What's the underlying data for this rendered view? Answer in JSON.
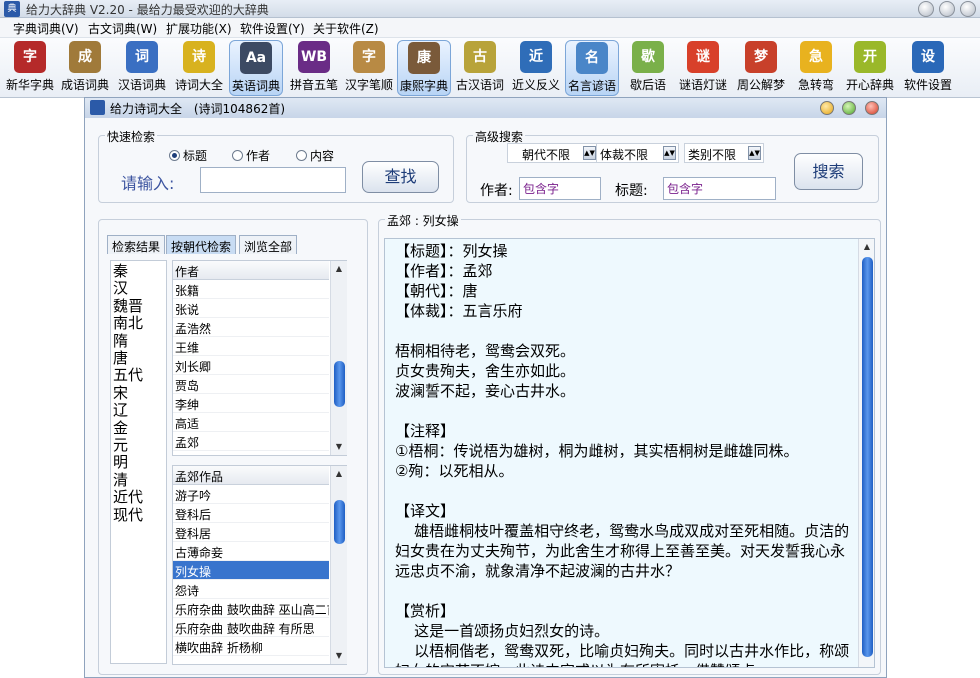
{
  "window": {
    "title": "给力大辞典 V2.20  -  最给力最受欢迎的大辞典"
  },
  "menu": [
    "字典词典(V)",
    "古文词典(W)",
    "扩展功能(X)",
    "软件设置(Y)",
    "关于软件(Z)"
  ],
  "toolbar": [
    {
      "label": "新华字典",
      "icon": "dictionary-icon",
      "color": "#b52a2a",
      "glyph": "字"
    },
    {
      "label": "成语词典",
      "icon": "idiom-book-icon",
      "color": "#a07a3a",
      "glyph": "成"
    },
    {
      "label": "汉语词典",
      "icon": "chinese-dict-icon",
      "color": "#3a6fc2",
      "glyph": "词"
    },
    {
      "label": "诗词大全",
      "icon": "poetry-icon",
      "color": "#d8b21f",
      "glyph": "诗"
    },
    {
      "label": "英语词典",
      "icon": "english-dict-icon",
      "color": "#3c4a63",
      "glyph": "Aa"
    },
    {
      "label": "拼音五笔",
      "icon": "wubi-icon",
      "color": "#6a2c86",
      "glyph": "WB"
    },
    {
      "label": "汉字笔顺",
      "icon": "stroke-order-icon",
      "color": "#b88a44",
      "glyph": "字"
    },
    {
      "label": "康熙字典",
      "icon": "kangxi-icon",
      "color": "#7a5a3a",
      "glyph": "康"
    },
    {
      "label": "古汉语词",
      "icon": "ancient-chinese-icon",
      "color": "#b8a33a",
      "glyph": "古"
    },
    {
      "label": "近义反义",
      "icon": "synonym-icon",
      "color": "#2f6db8",
      "glyph": "近"
    },
    {
      "label": "名言谚语",
      "icon": "proverb-icon",
      "color": "#4a86c8",
      "glyph": "名"
    },
    {
      "label": "歇后语",
      "icon": "xiehouyu-icon",
      "color": "#7ab04a",
      "glyph": "歇"
    },
    {
      "label": "谜语灯谜",
      "icon": "riddle-icon",
      "color": "#d8402a",
      "glyph": "谜"
    },
    {
      "label": "周公解梦",
      "icon": "dream-icon",
      "color": "#c8402a",
      "glyph": "梦"
    },
    {
      "label": "急转弯",
      "icon": "lightbulb-icon",
      "color": "#e8b21f",
      "glyph": "急"
    },
    {
      "label": "开心辞典",
      "icon": "happy-dict-icon",
      "color": "#9ab82a",
      "glyph": "开"
    },
    {
      "label": "软件设置",
      "icon": "gear-icon",
      "color": "#2a68b8",
      "glyph": "设"
    }
  ],
  "child": {
    "title": "给力诗词大全",
    "count": "(诗词104862首)"
  },
  "quick_search": {
    "label": "快速检索",
    "radios": [
      {
        "label": "标题",
        "checked": true
      },
      {
        "label": "作者",
        "checked": false
      },
      {
        "label": "内容",
        "checked": false
      }
    ],
    "prompt": "请输入:",
    "button": "查找"
  },
  "advanced_search": {
    "label": "高级搜索",
    "selects": [
      "朝代不限",
      "体裁不限",
      "类别不限"
    ],
    "author_label": "作者:",
    "author_value": "包含字",
    "title_label": "标题:",
    "title_value": "包含字",
    "button": "搜索"
  },
  "tabs": [
    "检索结果",
    "按朝代检索",
    "浏览全部"
  ],
  "dynasties": [
    "秦",
    "汉",
    "魏晋",
    "南北",
    "隋",
    "唐",
    "五代",
    "宋",
    "辽",
    "金",
    "元",
    "明",
    "清",
    "近代",
    "现代"
  ],
  "author_list": {
    "header": "作者",
    "items": [
      "张籍",
      "张说",
      "孟浩然",
      "王维",
      "刘长卿",
      "贾岛",
      "李绅",
      "高适",
      "孟郊"
    ]
  },
  "works_list": {
    "header": "孟郊作品",
    "items": [
      "游子吟",
      "登科后",
      "登科居",
      "古薄命妾",
      "列女操",
      "怨诗",
      "乐府杂曲 鼓吹曲辞 巫山高二首",
      "乐府杂曲 鼓吹曲辞 有所思",
      "横吹曲辞 折杨柳"
    ],
    "selected_index": 4
  },
  "reader": {
    "caption": "孟郊 : 列女操",
    "text": "【标题】：列女操\n【作者】：孟郊\n【朝代】：唐\n【体裁】：五言乐府\n\n梧桐相待老，鸳鸯会双死。\n贞女贵殉夫，舍生亦如此。\n波澜誓不起，妾心古井水。\n\n【注释】\n①梧桐：传说梧为雄树，桐为雌树，其实梧桐树是雌雄同株。\n②殉：以死相从。\n\n【译文】\n    雄梧雌桐枝叶覆盖相守终老，鸳鸯水鸟成双成对至死相随。贞洁的妇女贵在为丈夫殉节，为此舍生才称得上至善至美。对天发誓我心永远忠贞不渝，就象清净不起波澜的古井水？\n\n【赏析】\n    这是一首颂扬贞妇烈女的诗。\n    以梧桐偕老，鸳鸯双死，比喻贞妇殉夫。同时以古井水作比，称颂妇女的守节不嫁。此诗内容或以为有所寄托，借赞颂贞"
  }
}
